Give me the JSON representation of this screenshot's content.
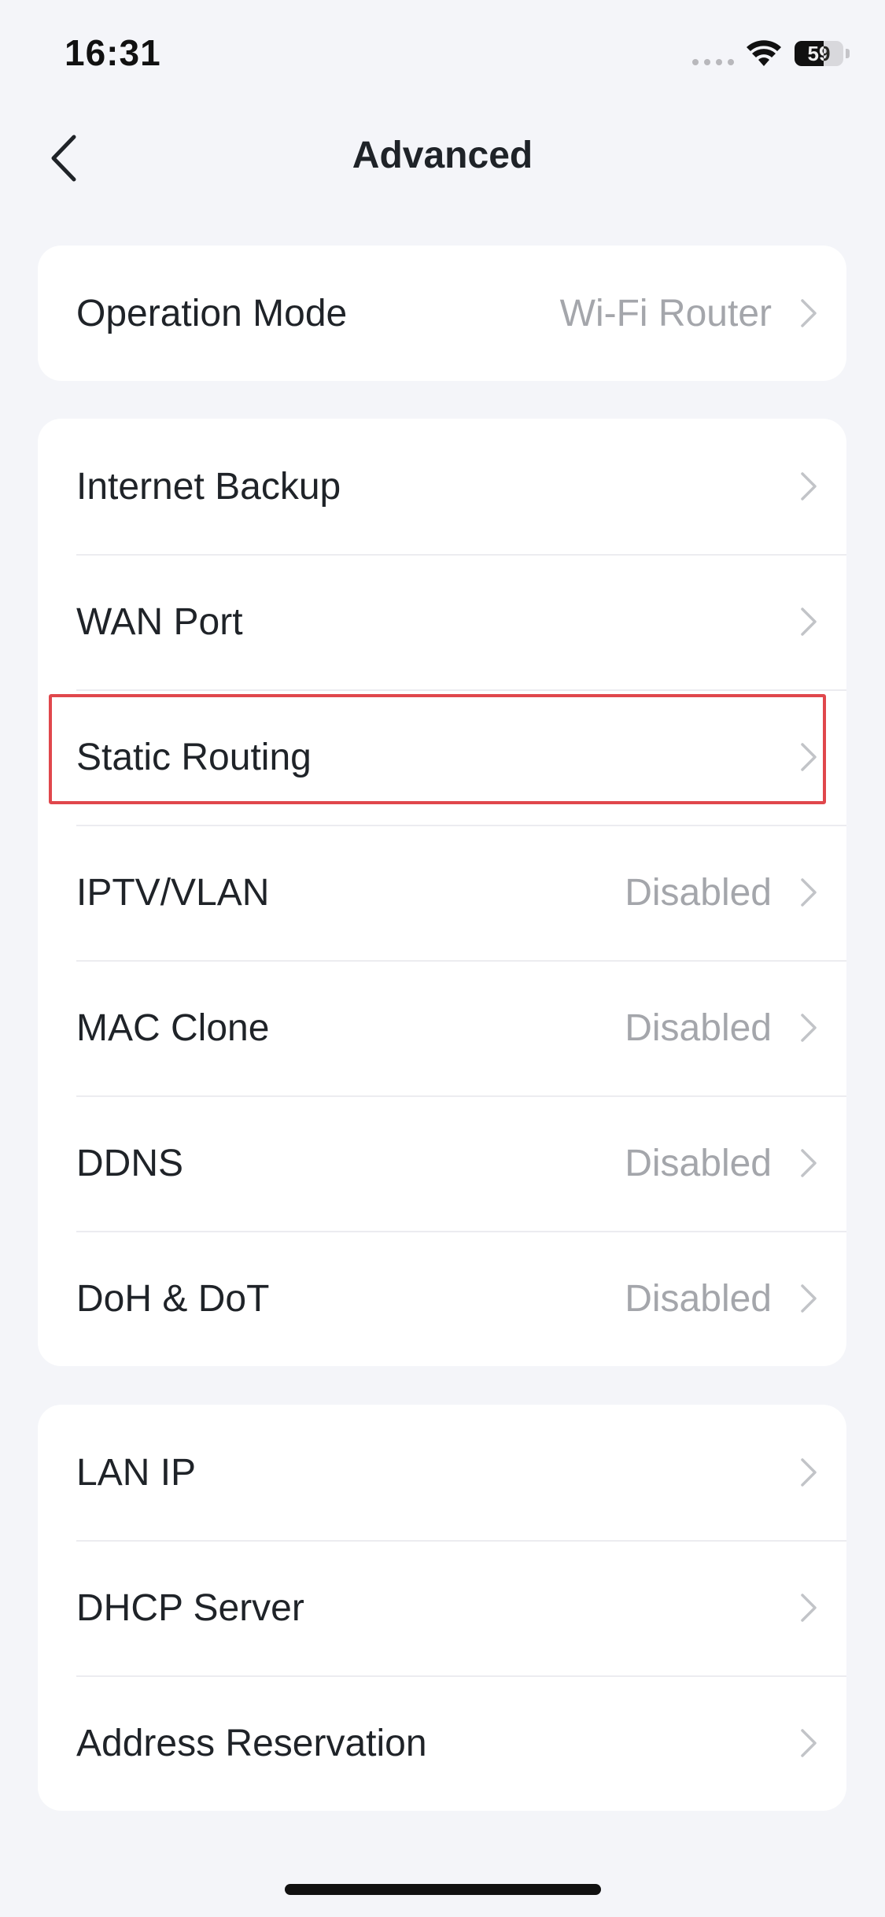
{
  "status_bar": {
    "time": "16:31",
    "battery_level": "59"
  },
  "header": {
    "title": "Advanced"
  },
  "groups": [
    {
      "items": [
        {
          "label": "Operation Mode",
          "value": "Wi-Fi Router"
        }
      ]
    },
    {
      "items": [
        {
          "label": "Internet Backup",
          "value": ""
        },
        {
          "label": "WAN Port",
          "value": ""
        },
        {
          "label": "Static Routing",
          "value": ""
        },
        {
          "label": "IPTV/VLAN",
          "value": "Disabled"
        },
        {
          "label": "MAC Clone",
          "value": "Disabled"
        },
        {
          "label": "DDNS",
          "value": "Disabled"
        },
        {
          "label": "DoH & DoT",
          "value": "Disabled"
        }
      ]
    },
    {
      "items": [
        {
          "label": "LAN IP",
          "value": ""
        },
        {
          "label": "DHCP Server",
          "value": ""
        },
        {
          "label": "Address Reservation",
          "value": ""
        }
      ]
    }
  ],
  "colors": {
    "background": "#f4f5f9",
    "card": "#ffffff",
    "highlight": "#e0474c",
    "secondary_text": "#a4a6ab"
  }
}
